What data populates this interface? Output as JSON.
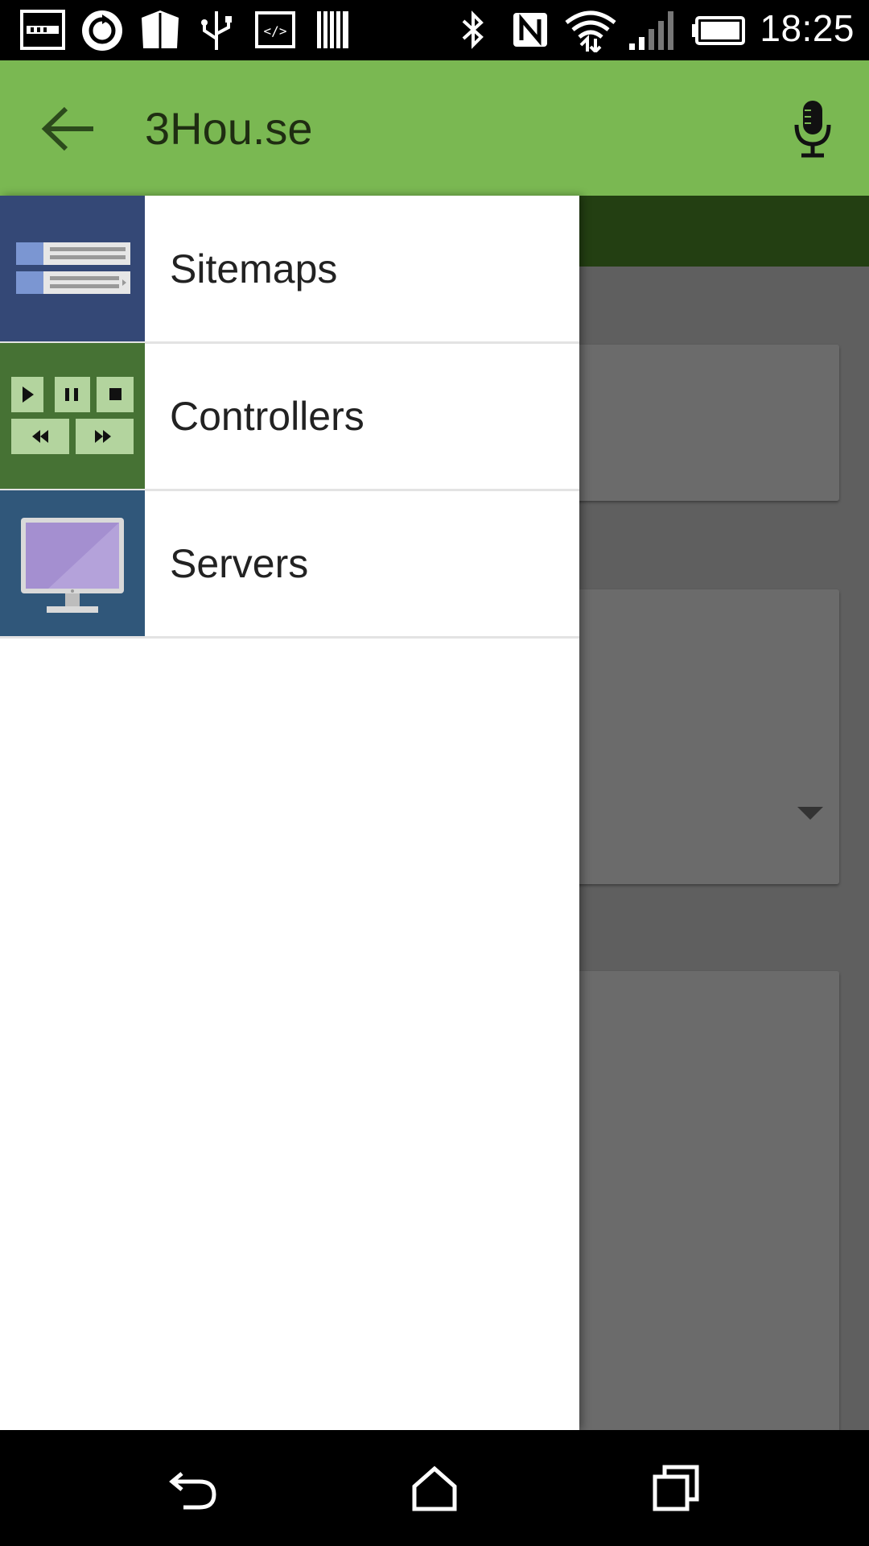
{
  "status_bar": {
    "time": "18:25",
    "left_icons": [
      "notification-icon",
      "sync-icon",
      "shield-icon",
      "usb-icon",
      "code-icon",
      "barcode-icon"
    ],
    "right_icons": [
      "bluetooth-icon",
      "nfc-icon",
      "wifi-icon",
      "signal-icon",
      "battery-icon"
    ]
  },
  "app_bar": {
    "title": "3Hou.se",
    "back_icon": "arrow-back-icon",
    "mic_icon": "microphone-icon",
    "color": "#7ab852"
  },
  "drawer": {
    "items": [
      {
        "label": "Sitemaps",
        "icon": "sitemap-icon",
        "tile_color": "#344876"
      },
      {
        "label": "Controllers",
        "icon": "media-controls-icon",
        "tile_color": "#467234"
      },
      {
        "label": "Servers",
        "icon": "monitor-icon",
        "tile_color": "#30577a"
      }
    ]
  },
  "nav_bar": {
    "buttons": [
      "back-nav-icon",
      "home-nav-icon",
      "recents-nav-icon"
    ]
  }
}
